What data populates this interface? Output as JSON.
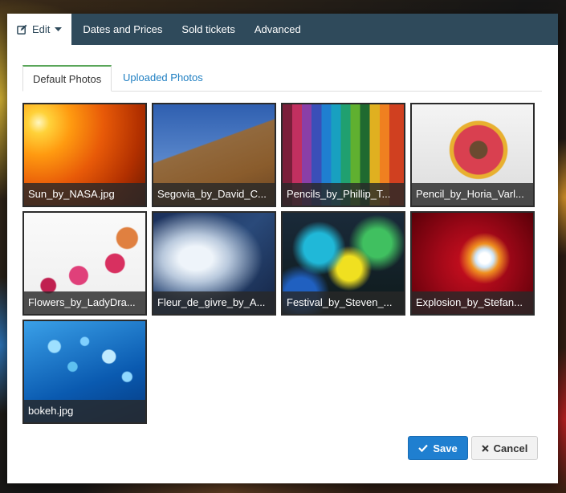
{
  "nav": {
    "edit_label": "Edit",
    "tabs": [
      "Dates and Prices",
      "Sold tickets",
      "Advanced"
    ]
  },
  "photo_tabs": {
    "default_label": "Default Photos",
    "uploaded_label": "Uploaded Photos"
  },
  "photos": [
    "Sun_by_NASA.jpg",
    "Segovia_by_David_C...",
    "Pencils_by_Phillip_T...",
    "Pencil_by_Horia_Varl...",
    "Flowers_by_LadyDra...",
    "Fleur_de_givre_by_A...",
    "Festival_by_Steven_...",
    "Explosion_by_Stefan...",
    "bokeh.jpg"
  ],
  "buttons": {
    "save_label": "Save",
    "cancel_label": "Cancel"
  },
  "icons": {
    "edit": "pencil-square-icon",
    "caret": "caret-down-icon",
    "save": "check-icon",
    "cancel": "close-icon"
  },
  "colors": {
    "nav_bg": "#2f4a5b",
    "active_subtab_accent": "#5aa65a",
    "link": "#1f7fc2",
    "primary": "#1f7fd0"
  }
}
